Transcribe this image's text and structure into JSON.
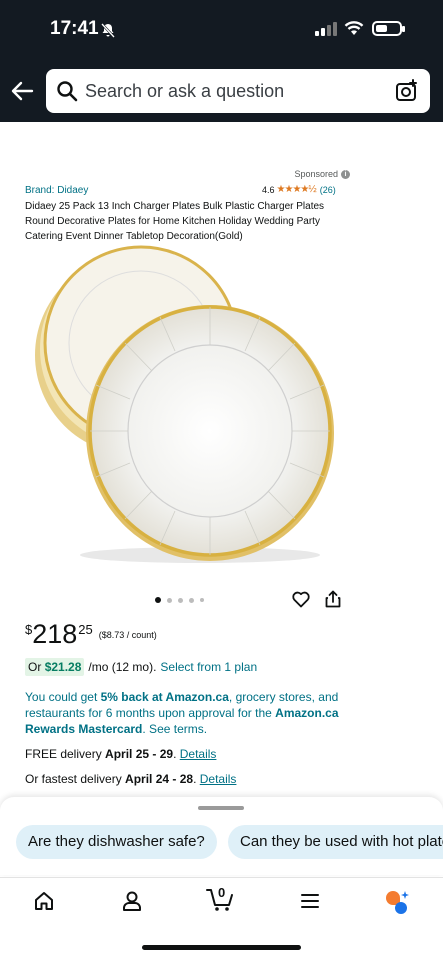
{
  "status_bar": {
    "time": "17:41",
    "icons": [
      "silent-bell-icon",
      "signal-icon",
      "wifi-icon",
      "battery-icon"
    ]
  },
  "header": {
    "back_icon": "back-arrow-icon",
    "search_placeholder": "Search or ask a question",
    "camera_icon": "camera-search-icon",
    "background_color": "#131a22"
  },
  "product": {
    "sponsored_label": "Sponsored",
    "brand_label": "Brand: Didaey",
    "rating_value": "4.6",
    "rating_stars": "★★★★½",
    "rating_count": "(26)",
    "title": "Didaey 25 Pack 13 Inch Charger Plates Bulk Plastic Charger Plates Round Decorative Plates for Home Kitchen Holiday Wedding Party Catering Event Dinner Tabletop Decoration(Gold)",
    "image_count": 5,
    "active_image_index": 0
  },
  "price": {
    "currency": "$",
    "whole": "218",
    "fraction": "25",
    "unit_price": "($8.73 / count)"
  },
  "monthly": {
    "prefix": "Or",
    "amount": "$21.28",
    "term": "/mo (12 mo).",
    "plan_link": "Select from 1 plan"
  },
  "rewards": {
    "text_a": "You could get ",
    "bold_a": "5% back at Amazon.ca",
    "text_b": ", grocery stores, and restaurants for 6 months upon approval for the ",
    "bold_b": "Amazon.ca Rewards Mastercard",
    "text_c": ". See terms."
  },
  "delivery": {
    "free_prefix": "FREE delivery ",
    "free_dates": "April 25 - 29",
    "fast_prefix": "Or fastest delivery ",
    "fast_dates": "April 24 - 28",
    "details_link": "Details"
  },
  "suggestions": [
    "Are they dishwasher safe?",
    "Can they be used with hot plates?"
  ],
  "bottom_nav": {
    "items": [
      "home-icon",
      "account-icon",
      "cart-icon",
      "menu-icon",
      "rufus-icon"
    ],
    "cart_count": "0"
  },
  "colors": {
    "link": "#007185",
    "star": "#de7921",
    "chip_bg": "#dff0f8",
    "green": "#067d62"
  }
}
